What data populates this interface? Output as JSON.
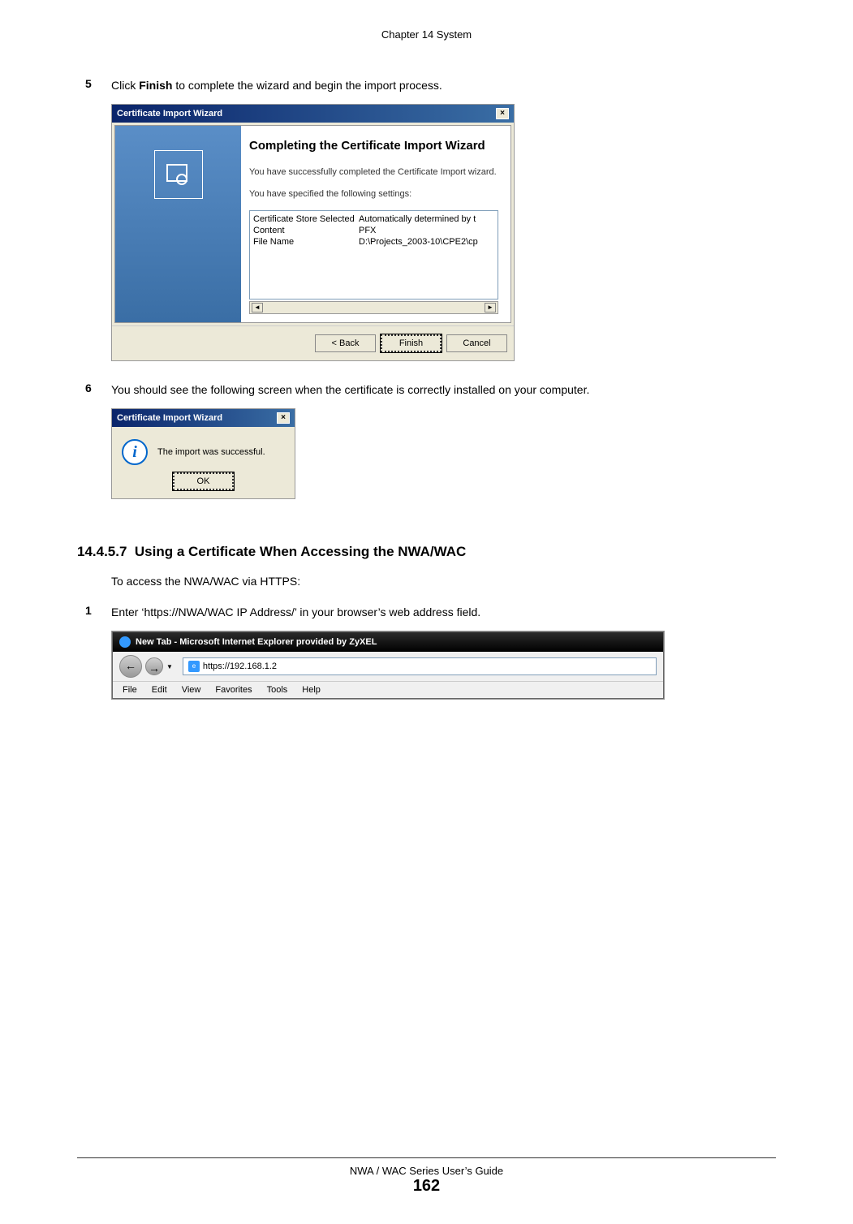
{
  "header": {
    "chapter": "Chapter 14 System"
  },
  "step5": {
    "num": "5",
    "text_before": "Click ",
    "bold": "Finish",
    "text_after": " to complete the wizard and begin the import process."
  },
  "dialog1": {
    "title": "Certificate Import Wizard",
    "heading": "Completing the Certificate Import Wizard",
    "body1": "You have successfully completed the Certificate Import wizard.",
    "body2": "You have specified the following settings:",
    "rows": [
      {
        "label": "Certificate Store Selected",
        "value": "Automatically determined by t"
      },
      {
        "label": "Content",
        "value": "PFX"
      },
      {
        "label": "File Name",
        "value": "D:\\Projects_2003-10\\CPE2\\cp"
      }
    ],
    "back": "< Back",
    "finish": "Finish",
    "cancel": "Cancel"
  },
  "step6": {
    "num": "6",
    "text": "You should see the following screen when the certificate is correctly installed on your computer."
  },
  "dialog2": {
    "title": "Certificate Import Wizard",
    "message": "The import was successful.",
    "ok": "OK"
  },
  "section": {
    "number": "14.4.5.7",
    "title": "Using a Certificate When Accessing the NWA/WAC",
    "intro": "To access the NWA/WAC via HTTPS:"
  },
  "step1": {
    "num": "1",
    "text": "Enter ‘https://NWA/WAC IP Address/’ in your browser’s web address field."
  },
  "browser": {
    "title": "New Tab - Microsoft Internet Explorer provided by ZyXEL",
    "url": "https://192.168.1.2",
    "menu": [
      "File",
      "Edit",
      "View",
      "Favorites",
      "Tools",
      "Help"
    ]
  },
  "footer": {
    "guide": "NWA / WAC Series User’s Guide",
    "page": "162"
  }
}
